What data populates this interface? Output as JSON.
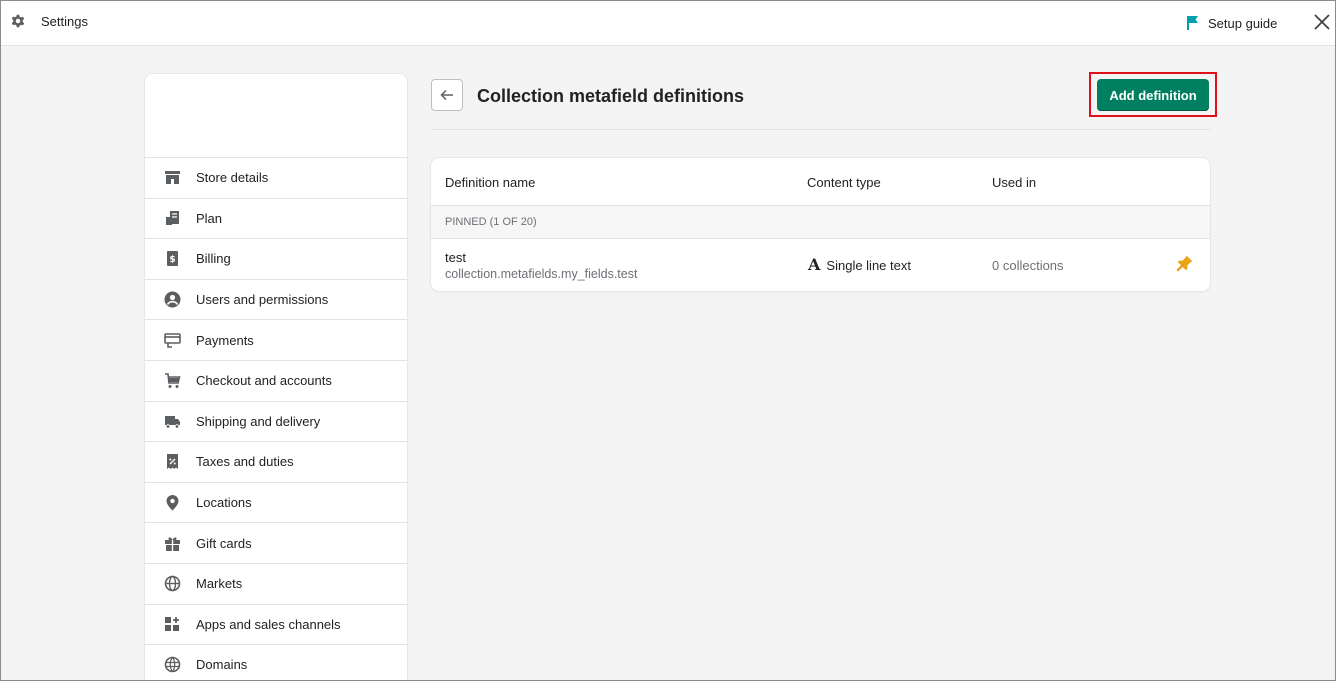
{
  "topbar": {
    "title": "Settings",
    "setup_label": "Setup guide"
  },
  "sidebar": {
    "items": [
      {
        "label": "Store details",
        "icon": "store-icon"
      },
      {
        "label": "Plan",
        "icon": "plan-icon"
      },
      {
        "label": "Billing",
        "icon": "billing-icon"
      },
      {
        "label": "Users and permissions",
        "icon": "user-icon"
      },
      {
        "label": "Payments",
        "icon": "payments-icon"
      },
      {
        "label": "Checkout and accounts",
        "icon": "cart-icon"
      },
      {
        "label": "Shipping and delivery",
        "icon": "truck-icon"
      },
      {
        "label": "Taxes and duties",
        "icon": "tax-icon"
      },
      {
        "label": "Locations",
        "icon": "location-icon"
      },
      {
        "label": "Gift cards",
        "icon": "gift-icon"
      },
      {
        "label": "Markets",
        "icon": "globe-icon"
      },
      {
        "label": "Apps and sales channels",
        "icon": "apps-icon"
      },
      {
        "label": "Domains",
        "icon": "domain-icon"
      }
    ]
  },
  "main": {
    "title": "Collection metafield definitions",
    "add_button": "Add definition",
    "table": {
      "headers": [
        "Definition name",
        "Content type",
        "Used in"
      ],
      "pinned_label": "PINNED (1 OF 20)",
      "rows": [
        {
          "name": "test",
          "namespace": "collection.metafields.my_fields.test",
          "content_type": "Single line text",
          "used_in": "0 collections"
        }
      ]
    }
  },
  "colors": {
    "primary": "#008060",
    "highlight": "#e0101a",
    "pin": "#e8a317",
    "flag": "#00a0ac"
  }
}
